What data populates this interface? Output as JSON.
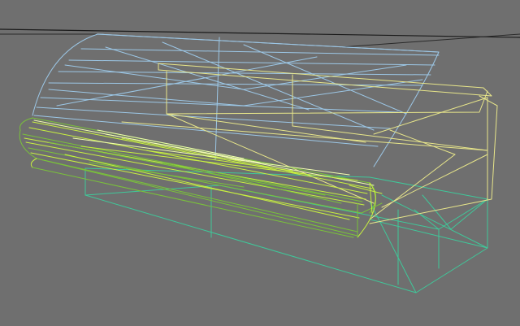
{
  "viewport": {
    "background": "#6f6f6f",
    "content": "wireframe-3d-model",
    "colors": {
      "grid": "#000000",
      "top_cover": "#9cc7e6",
      "glass_frame": "#e8e68a",
      "tube_bright": "#c8f040",
      "tube_dark": "#7ac23a",
      "tube_highlight": "#f2ffb0",
      "base": "#3fc89a"
    }
  }
}
